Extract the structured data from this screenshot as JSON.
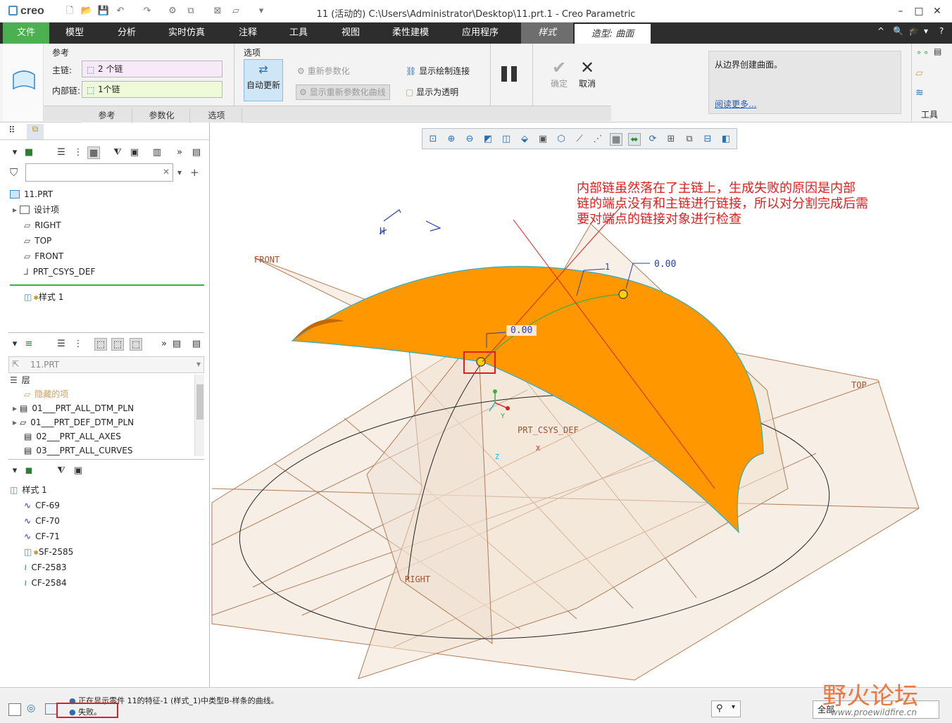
{
  "window": {
    "app_logo": "creo",
    "title": "11 (活动的) C:\\Users\\Administrator\\Desktop\\11.prt.1 - Creo Parametric",
    "controls": [
      "–",
      "□",
      "✕"
    ]
  },
  "menu": {
    "tabs": [
      "文件",
      "模型",
      "分析",
      "实时仿真",
      "注释",
      "工具",
      "视图",
      "柔性建模",
      "应用程序",
      "样式",
      "造型: 曲面"
    ],
    "right_icons": [
      "^",
      "🔍",
      "🎓",
      "▾",
      "?"
    ]
  },
  "ribbon": {
    "group_ref": "参考",
    "main_chain_label": "主链:",
    "main_chain_value": "2 个链",
    "internal_chain_label": "内部链:",
    "internal_chain_value": "1个链",
    "group_options": "选项",
    "auto_update": "自动更新",
    "reparam": "重新参数化",
    "show_reparam_curve": "显示重新参数化曲线",
    "show_sketch_conn": "显示绘制连接",
    "show_transparent": "显示为透明",
    "ok": "确定",
    "cancel": "取消",
    "sub_tabs": [
      "参考",
      "参数化",
      "选项"
    ],
    "help_text": "从边界创建曲面。",
    "read_more": "阅读更多...",
    "tools": "工具"
  },
  "model_tree": {
    "root": "11.PRT",
    "items": [
      "设计项",
      "RIGHT",
      "TOP",
      "FRONT",
      "PRT_CSYS_DEF"
    ],
    "feature": "样式 1",
    "search_placeholder": ""
  },
  "layer_tree": {
    "model": "11.PRT",
    "layer_header": "层",
    "items": [
      "隐藏的项",
      "01___PRT_ALL_DTM_PLN",
      "01___PRT_DEF_DTM_PLN",
      "02___PRT_ALL_AXES",
      "03___PRT_ALL_CURVES"
    ]
  },
  "style_tree": {
    "root": "样式 1",
    "items": [
      "CF-69",
      "CF-70",
      "CF-71",
      "SF-2585",
      "CF-2583",
      "CF-2584"
    ]
  },
  "viewport": {
    "annotation": [
      "内部链虽然落在了主链上，生成失败的原因是内部",
      "链的端点没有和主链进行链接，所以对分割完成后需",
      "要对端点的链接对象进行检查"
    ],
    "dim1": "0.00",
    "dim2": "0.00",
    "dim3": "1",
    "labels": {
      "front": "FRONT",
      "top": "TOP",
      "right": "RIGHT",
      "csys": "PRT_CSYS_DEF",
      "x": "X",
      "y": "Y",
      "z": "Z",
      "h": "H"
    },
    "colors": {
      "surface": "#ff9800",
      "annotation": "#e02020",
      "datum": "#a0522d"
    }
  },
  "status": {
    "line1": "正在显示零件 11的特征-1 (样式_1)中类型B-样条的曲线。",
    "line2": "失败。",
    "filter": "全部",
    "watermark": "野火论坛",
    "watermark_url": "www.proewildfire.cn"
  }
}
